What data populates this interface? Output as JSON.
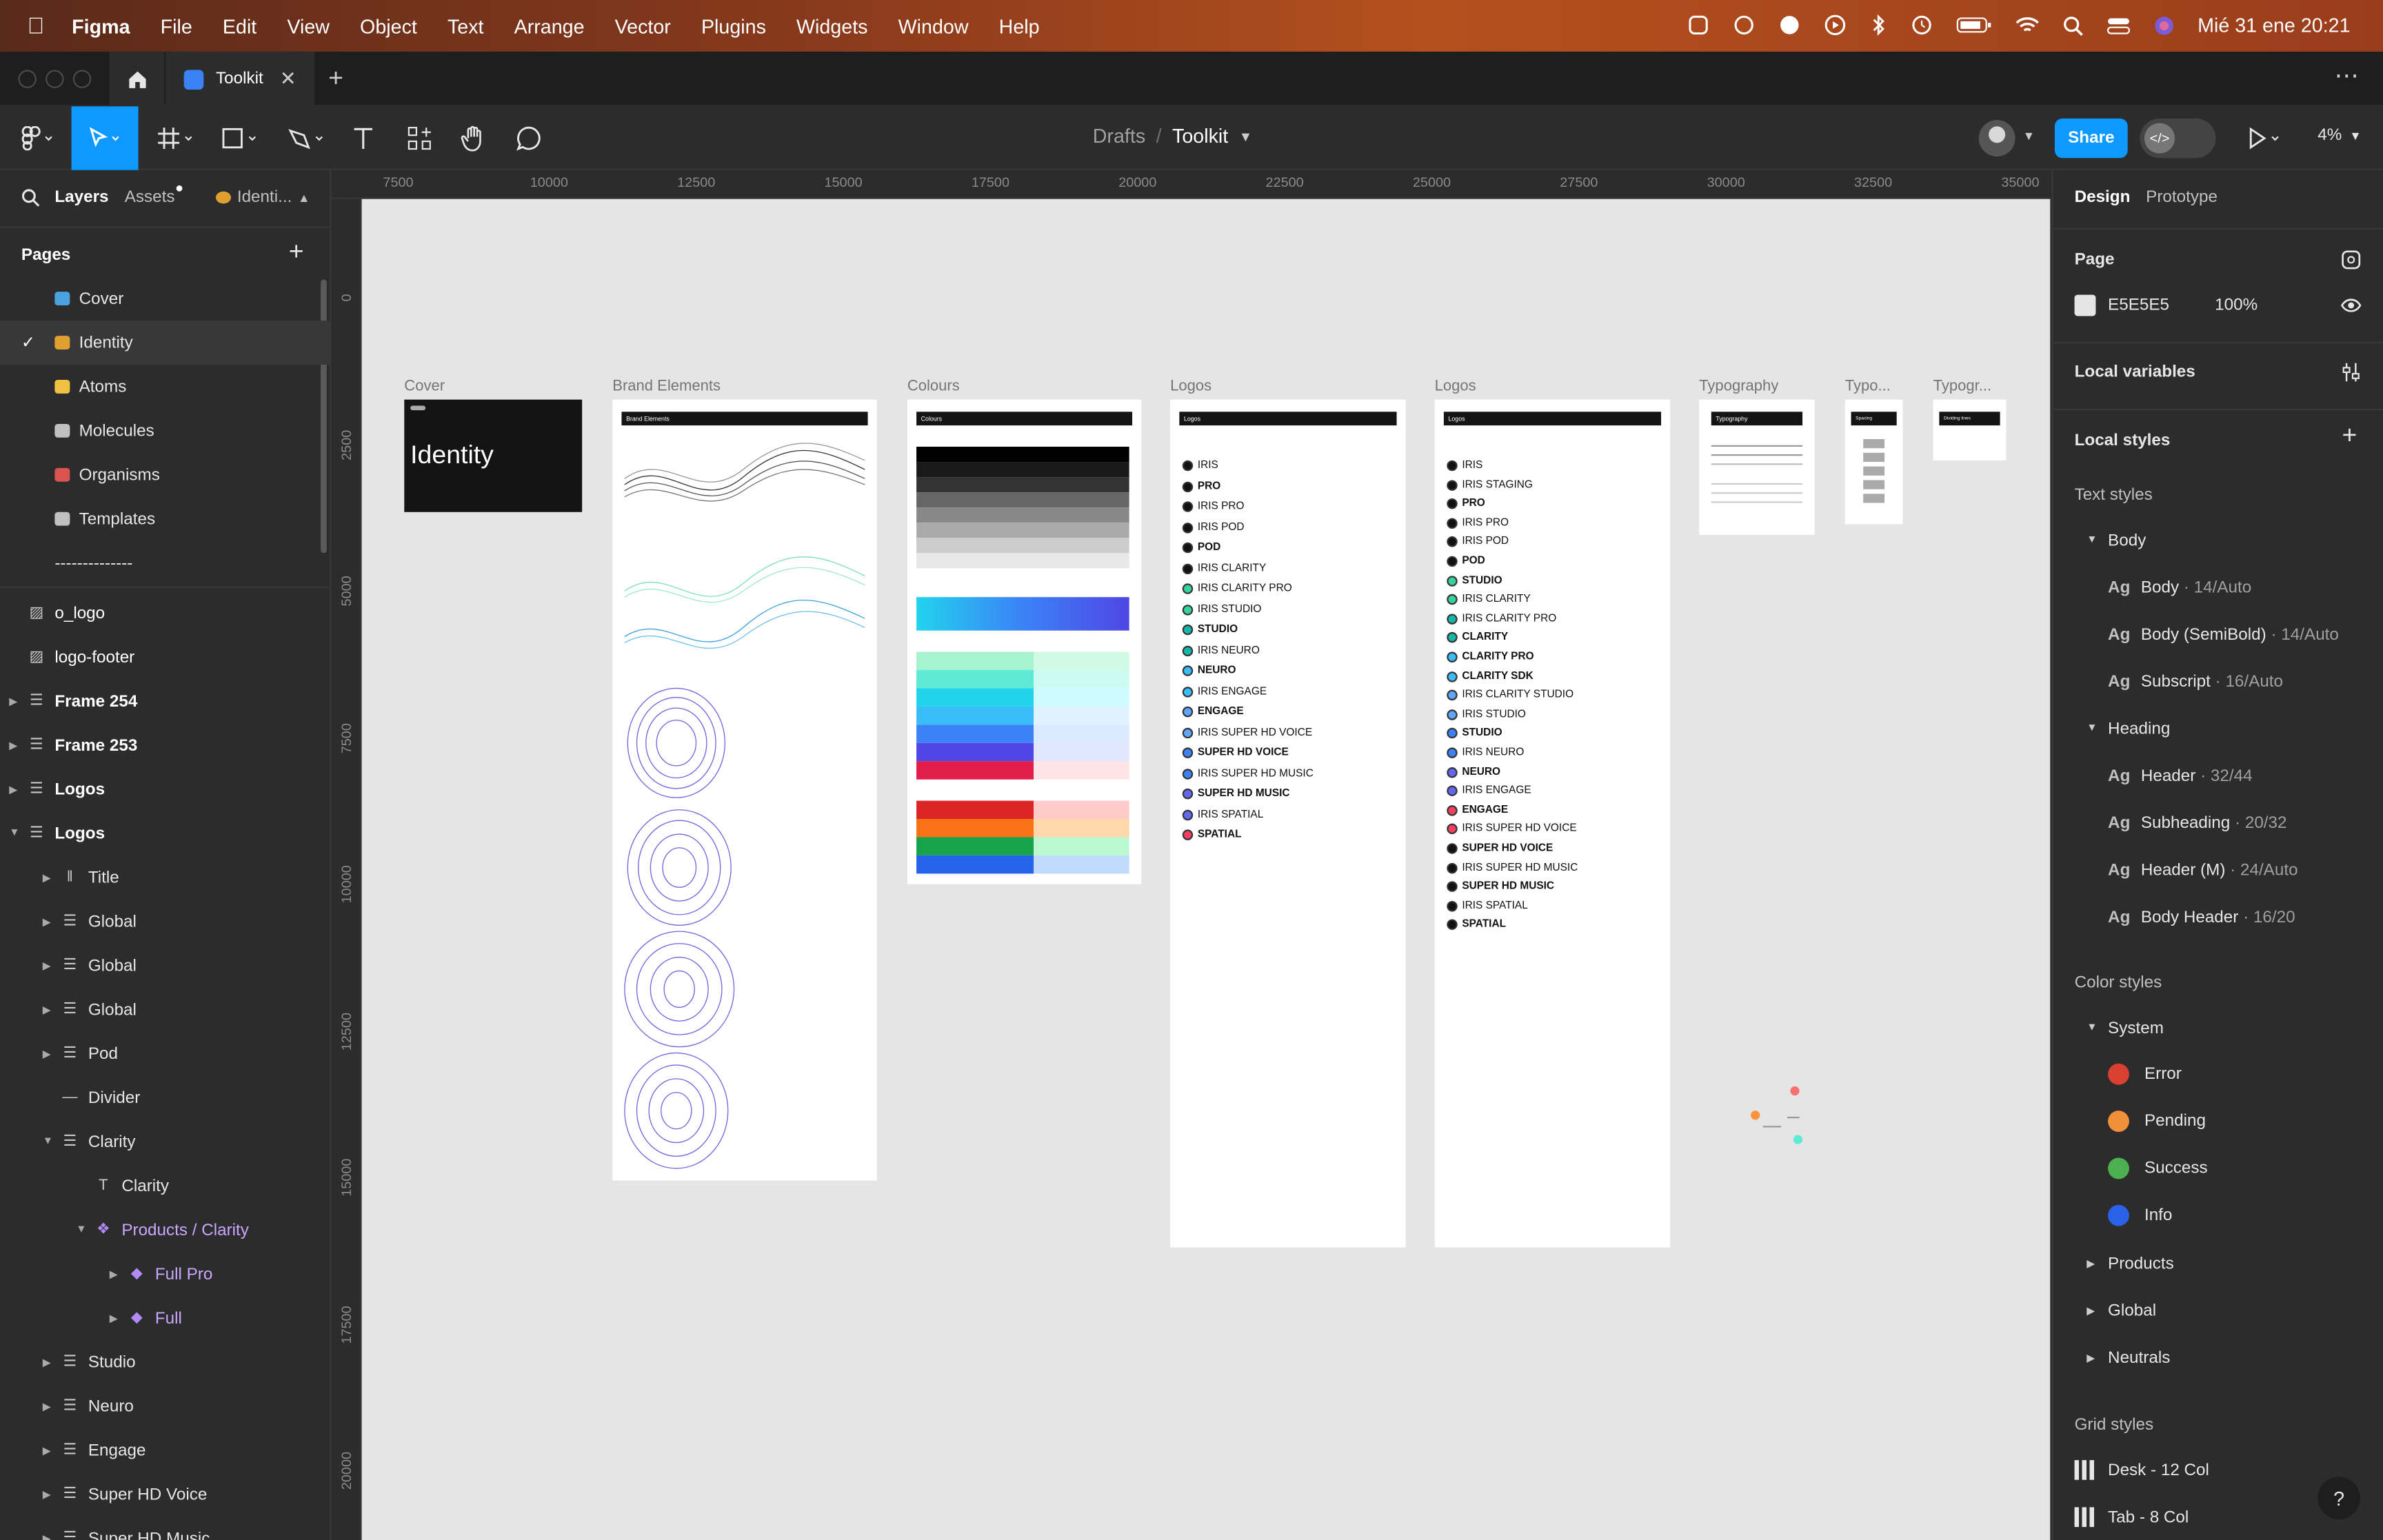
{
  "menubar": {
    "app": "Figma",
    "items": [
      "File",
      "Edit",
      "View",
      "Object",
      "Text",
      "Arrange",
      "Vector",
      "Plugins",
      "Widgets",
      "Window",
      "Help"
    ],
    "clock": "Mié 31 ene 20:21"
  },
  "tab": {
    "title": "Toolkit"
  },
  "toolbar": {
    "breadcrumb_root": "Drafts",
    "breadcrumb_sep": "/",
    "file_name": "Toolkit",
    "share_label": "Share",
    "zoom": "4%"
  },
  "left_panel": {
    "tabs": {
      "layers": "Layers",
      "assets": "Assets",
      "page_chip": "Identi..."
    },
    "pages_title": "Pages",
    "pages": [
      {
        "label": "Cover",
        "icon": "gem-icon",
        "color": "#4aa3df"
      },
      {
        "label": "Identity",
        "icon": "palette-icon",
        "color": "#e0a030"
      },
      {
        "label": "Atoms",
        "icon": "atom-icon",
        "color": "#f0c040"
      },
      {
        "label": "Molecules",
        "icon": "folder-icon",
        "color": "#c0c0c0"
      },
      {
        "label": "Organisms",
        "icon": "bricks-icon",
        "color": "#d9534f"
      },
      {
        "label": "Templates",
        "icon": "folder-icon",
        "color": "#c0c0c0"
      },
      {
        "label": "--------------",
        "icon": "",
        "color": ""
      }
    ],
    "layers": [
      {
        "label": "o_logo",
        "icon": "image-icon",
        "indent": 0,
        "caret": ""
      },
      {
        "label": "logo-footer",
        "icon": "image-icon",
        "indent": 0,
        "caret": ""
      },
      {
        "label": "Frame 254",
        "icon": "autolayout-icon",
        "indent": 0,
        "caret": "right"
      },
      {
        "label": "Frame 253",
        "icon": "autolayout-icon",
        "indent": 0,
        "caret": "right"
      },
      {
        "label": "Logos",
        "icon": "autolayout-icon",
        "indent": 0,
        "caret": "right"
      },
      {
        "label": "Logos",
        "icon": "autolayout-icon",
        "indent": 0,
        "caret": "down"
      },
      {
        "label": "Title",
        "icon": "bars-icon",
        "indent": 1,
        "caret": "right"
      },
      {
        "label": "Global",
        "icon": "autolayout-icon",
        "indent": 1,
        "caret": "right"
      },
      {
        "label": "Global",
        "icon": "autolayout-icon",
        "indent": 1,
        "caret": "right"
      },
      {
        "label": "Global",
        "icon": "autolayout-icon",
        "indent": 1,
        "caret": "right"
      },
      {
        "label": "Pod",
        "icon": "autolayout-icon",
        "indent": 1,
        "caret": "right"
      },
      {
        "label": "Divider",
        "icon": "line-icon",
        "indent": 1,
        "caret": ""
      },
      {
        "label": "Clarity",
        "icon": "autolayout-icon",
        "indent": 1,
        "caret": "down"
      },
      {
        "label": "Clarity",
        "icon": "text-icon",
        "indent": 2,
        "caret": ""
      },
      {
        "label": "Products / Clarity",
        "icon": "component-icon",
        "indent": 2,
        "caret": "down"
      },
      {
        "label": "Full Pro",
        "icon": "variant-icon",
        "indent": 3,
        "caret": "right"
      },
      {
        "label": "Full",
        "icon": "variant-icon",
        "indent": 3,
        "caret": "right"
      },
      {
        "label": "Studio",
        "icon": "autolayout-icon",
        "indent": 1,
        "caret": "right"
      },
      {
        "label": "Neuro",
        "icon": "autolayout-icon",
        "indent": 1,
        "caret": "right"
      },
      {
        "label": "Engage",
        "icon": "autolayout-icon",
        "indent": 1,
        "caret": "right"
      },
      {
        "label": "Super HD Voice",
        "icon": "autolayout-icon",
        "indent": 1,
        "caret": "right"
      },
      {
        "label": "Super HD Music",
        "icon": "autolayout-icon",
        "indent": 1,
        "caret": "right"
      }
    ]
  },
  "rulers": {
    "h": [
      "7500",
      "10000",
      "12500",
      "15000",
      "17500",
      "20000",
      "22500",
      "25000",
      "27500",
      "30000",
      "32500",
      "35000"
    ],
    "v": [
      "0",
      "2500",
      "5000",
      "7500",
      "10000",
      "12500",
      "15000",
      "17500",
      "20000"
    ]
  },
  "canvas": {
    "frames": {
      "cover": {
        "label": "Cover",
        "title": "Identity"
      },
      "brand": {
        "label": "Brand Elements",
        "head": "Brand Elements"
      },
      "colours": {
        "label": "Colours",
        "head": "Colours"
      },
      "logos1": {
        "label": "Logos",
        "head": "Logos"
      },
      "logos2": {
        "label": "Logos",
        "head": "Logos"
      },
      "typo": {
        "label": "Typography",
        "head": "Typography"
      },
      "typo2": {
        "label": "Typo...",
        "head": "Spacing"
      },
      "typo3": {
        "label": "Typogr...",
        "head": "Dividing lines"
      }
    },
    "logos1_lines": [
      "IRIS",
      "PRO",
      "IRIS PRO",
      "IRIS POD",
      "POD",
      "IRIS CLARITY",
      "IRIS CLARITY PRO",
      "IRIS STUDIO",
      "STUDIO",
      "IRIS NEURO",
      "NEURO",
      "IRIS ENGAGE",
      "ENGAGE",
      "IRIS SUPER HD VOICE",
      "SUPER HD VOICE",
      "IRIS SUPER HD MUSIC",
      "SUPER HD MUSIC",
      "IRIS SPATIAL",
      "SPATIAL"
    ],
    "logos2_lines": [
      "IRIS",
      "IRIS STAGING",
      "PRO",
      "IRIS PRO",
      "IRIS POD",
      "POD",
      "STUDIO",
      "IRIS CLARITY",
      "IRIS CLARITY PRO",
      "CLARITY",
      "CLARITY PRO",
      "CLARITY SDK",
      "IRIS CLARITY STUDIO",
      "IRIS STUDIO",
      "STUDIO",
      "IRIS NEURO",
      "NEURO",
      "IRIS ENGAGE",
      "ENGAGE",
      "IRIS SUPER HD VOICE",
      "SUPER HD VOICE",
      "IRIS SUPER HD MUSIC",
      "SUPER HD MUSIC",
      "IRIS SPATIAL",
      "SPATIAL"
    ]
  },
  "right_panel": {
    "tabs": {
      "design": "Design",
      "prototype": "Prototype"
    },
    "page_title": "Page",
    "page_color": "E5E5E5",
    "page_opacity": "100%",
    "local_variables": "Local variables",
    "local_styles": "Local styles",
    "text_styles_title": "Text styles",
    "text_groups": [
      {
        "name": "Body",
        "styles": [
          {
            "name": "Body",
            "sub": " · 14/Auto"
          },
          {
            "name": "Body (SemiBold)",
            "sub": " · 14/Auto"
          },
          {
            "name": "Subscript",
            "sub": " · 16/Auto"
          }
        ]
      },
      {
        "name": "Heading",
        "styles": [
          {
            "name": "Header",
            "sub": " · 32/44"
          },
          {
            "name": "Subheading",
            "sub": " · 20/32"
          },
          {
            "name": "Header (M)",
            "sub": " · 24/Auto"
          },
          {
            "name": "Body Header",
            "sub": " · 16/20"
          }
        ]
      }
    ],
    "color_styles_title": "Color styles",
    "color_group": "System",
    "colors": [
      {
        "name": "Error",
        "hex": "#d9402f"
      },
      {
        "name": "Pending",
        "hex": "#f0913a"
      },
      {
        "name": "Success",
        "hex": "#4caf50"
      },
      {
        "name": "Info",
        "hex": "#2962e8"
      }
    ],
    "color_collapsed": [
      "Products",
      "Global",
      "Neutrals"
    ],
    "grid_styles_title": "Grid styles",
    "grids": [
      "Desk - 12 Col",
      "Tab - 8 Col"
    ],
    "help": "?"
  }
}
